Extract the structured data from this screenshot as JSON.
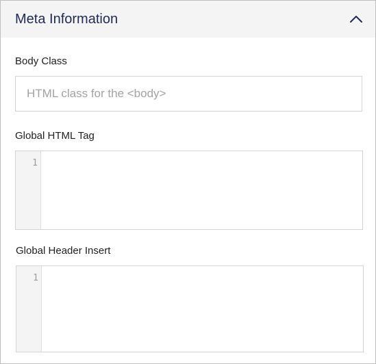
{
  "panel": {
    "title": "Meta Information",
    "toggle_icon": "chevron-up-icon"
  },
  "body_class": {
    "label": "Body Class",
    "value": "",
    "placeholder": "HTML class for the <body>"
  },
  "global_html_tag": {
    "label": "Global HTML Tag",
    "line_numbers": [
      "1"
    ]
  },
  "global_header_insert": {
    "label": "Global Header Insert",
    "line_numbers": [
      "1"
    ]
  },
  "colors": {
    "title": "#1e2a55",
    "header_bg": "#f4f4f5",
    "border": "#d4d4d8",
    "placeholder": "#a3a3a3"
  }
}
